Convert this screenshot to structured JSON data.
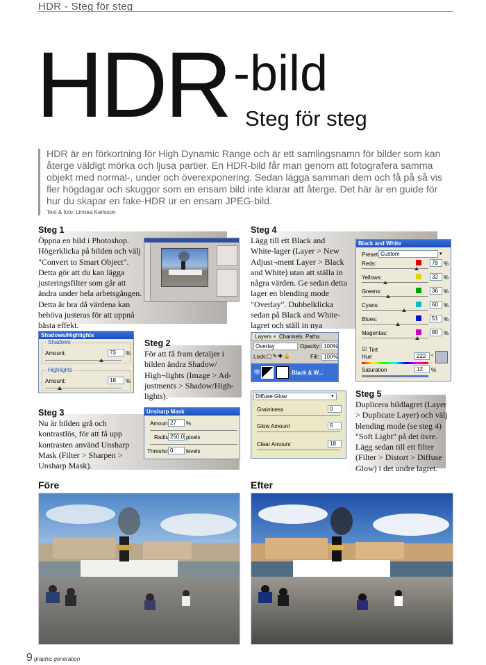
{
  "header": {
    "running_title": "HDR - Steg för steg"
  },
  "title": {
    "big": "HDR",
    "suffix": "-bild",
    "sub": "Steg för steg"
  },
  "intro": {
    "text": "HDR är en förkortning för High Dynamic Range och är ett samlingsnamn för bilder som kan återge väldigt mörka och ljusa partier. En HDR-bild får man genom att fotografera samma objekt med normal-, under och överexponering. Sedan lägga samman dem och få på så vis fler högdagar och skuggor som en ensam bild inte klarar att återge. Det här är en guide för hur du skapar en fake-HDR ur en ensam JPEG-bild.",
    "credit": "Text & foto: Linnea Karlsson"
  },
  "steps": [
    {
      "head": "Steg 1",
      "body": "Öppna en bild i Photoshop. Högerklicka på bilden och välj \"Convert to Smart Object\". Detta gör att du kan lägga justeringsfilter som går att ändra under hela arbetsgången. Detta är bra då värdena kan behöva justeras för att uppnå bästa effekt."
    },
    {
      "head": "Steg 2",
      "body": "För att få fram detaljer i bilden ändra Shadow/ High¬lights (Image > Ad­justments > Shadow/High­lights)."
    },
    {
      "head": "Steg 3",
      "body": "Nu är bilden grå och kontrastlös, för att få upp kontrasten använd Unsharp Mask (Filter > Sharpen > Unsharp Mask)."
    },
    {
      "head": "Steg 4",
      "body": "Lägg till ett Black and White-lager (Layer > New Adjust¬ment Layer > Black and White) utan att ställa in några värden. Ge sedan detta lager en blending mode \"Overlay\". Dubbelklicka sedan på Black and White-lagret och ställ in nya värden."
    },
    {
      "head": "Steg 5",
      "body": "Duplicera bildlagret (Layer > Duplicate Layer) och välj blending mode (se steg 4) \"Soft Light\" på det övre. Lägg sedan till ett filter (Filter > Distort > Diffuse Glow) i det undre lagret."
    }
  ],
  "shadows_dialog": {
    "title": "Shadows/Highlights",
    "shadows_label": "Shadows",
    "amount_label": "Amount:",
    "shadows_amount": "73",
    "highlights_label": "Highlights",
    "highlights_amount": "18",
    "unit": "%"
  },
  "unsharp_dialog": {
    "title": "Unsharp Mask",
    "amount_label": "Amount:",
    "amount": "27",
    "amount_unit": "%",
    "radius_label": "Radius:",
    "radius": "250,0",
    "radius_unit": "pixels",
    "threshold_label": "Threshold:",
    "threshold": "0",
    "threshold_unit": "levels"
  },
  "bw_dialog": {
    "title": "Black and White",
    "preset_label": "Preset:",
    "preset_value": "Custom",
    "rows": [
      {
        "label": "Reds:",
        "value": "79",
        "color": "#e00000"
      },
      {
        "label": "Yellows:",
        "value": "32",
        "color": "#e0d000"
      },
      {
        "label": "Greens:",
        "value": "36",
        "color": "#00a000"
      },
      {
        "label": "Cyans:",
        "value": "60",
        "color": "#00c0c0"
      },
      {
        "label": "Blues:",
        "value": "51",
        "color": "#0010d0"
      },
      {
        "label": "Magentas:",
        "value": "80",
        "color": "#d000c0"
      }
    ],
    "unit": "%",
    "tint_label": "Tint",
    "hue_label": "Hue",
    "hue_value": "222",
    "hue_unit": "°",
    "sat_label": "Saturation",
    "sat_value": "12",
    "sat_unit": "%"
  },
  "layers_panel": {
    "tabs": [
      "Layers ×",
      "Channels",
      "Paths"
    ],
    "blend_mode": "Overlay",
    "opacity_label": "Opacity:",
    "opacity": "100%",
    "lock_label": "Lock:",
    "fill_label": "Fill:",
    "fill": "100%",
    "layer_name": "Black & W..."
  },
  "glow_dialog": {
    "filter": "Diffuse Glow",
    "graininess_label": "Graininess",
    "graininess": "0",
    "glow_label": "Glow Amount",
    "glow": "6",
    "clear_label": "Clear Amount",
    "clear": "18"
  },
  "compare": {
    "before": "Före",
    "after": "Efter"
  },
  "footer": {
    "page": "9",
    "brand": "graphic generation"
  }
}
